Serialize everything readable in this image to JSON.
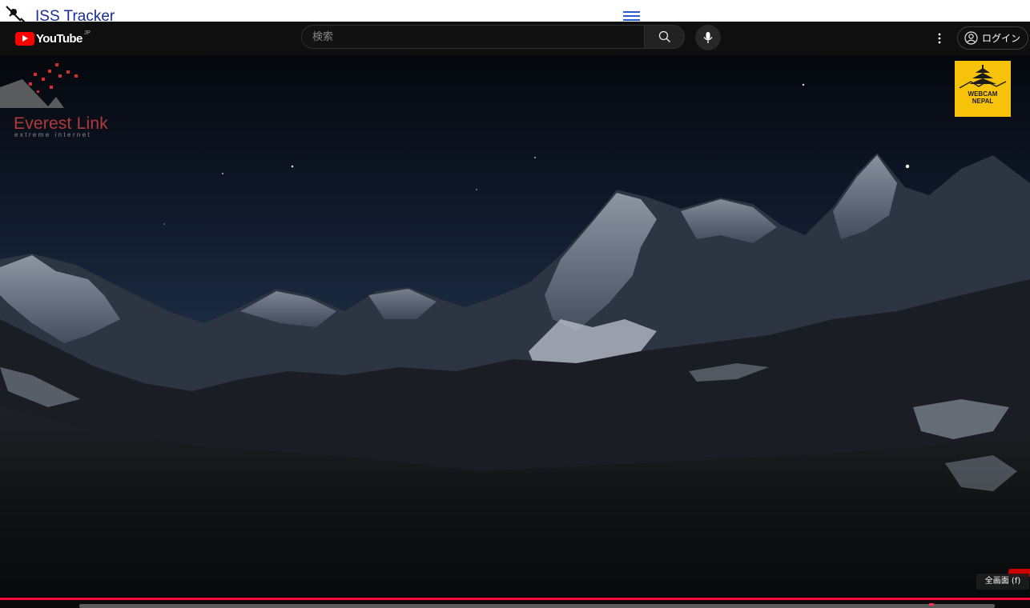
{
  "site": {
    "title": "ISS Tracker",
    "logo_icon": "satellite-icon",
    "menu_icon": "hamburger-icon"
  },
  "youtube": {
    "logo_text": "YouTube",
    "region": "JP",
    "search_placeholder": "検索",
    "search_icon": "search-icon",
    "mic_icon": "mic-icon",
    "more_icon": "more-vert-icon",
    "login_label": "ログイン",
    "login_icon": "account-circle-icon",
    "brand_color": "#ff0000"
  },
  "video": {
    "watermark_left": {
      "name": "Everest Link",
      "tagline": "extreme internet",
      "color": "#b2393c"
    },
    "watermark_right": {
      "line1": "WEBCAM",
      "line2": "NEPAL",
      "background": "#f7c30a"
    },
    "fullscreen_tooltip": "全画面 (f)",
    "progress_color": "#ff0f3a",
    "progress_fraction": 1.0
  }
}
